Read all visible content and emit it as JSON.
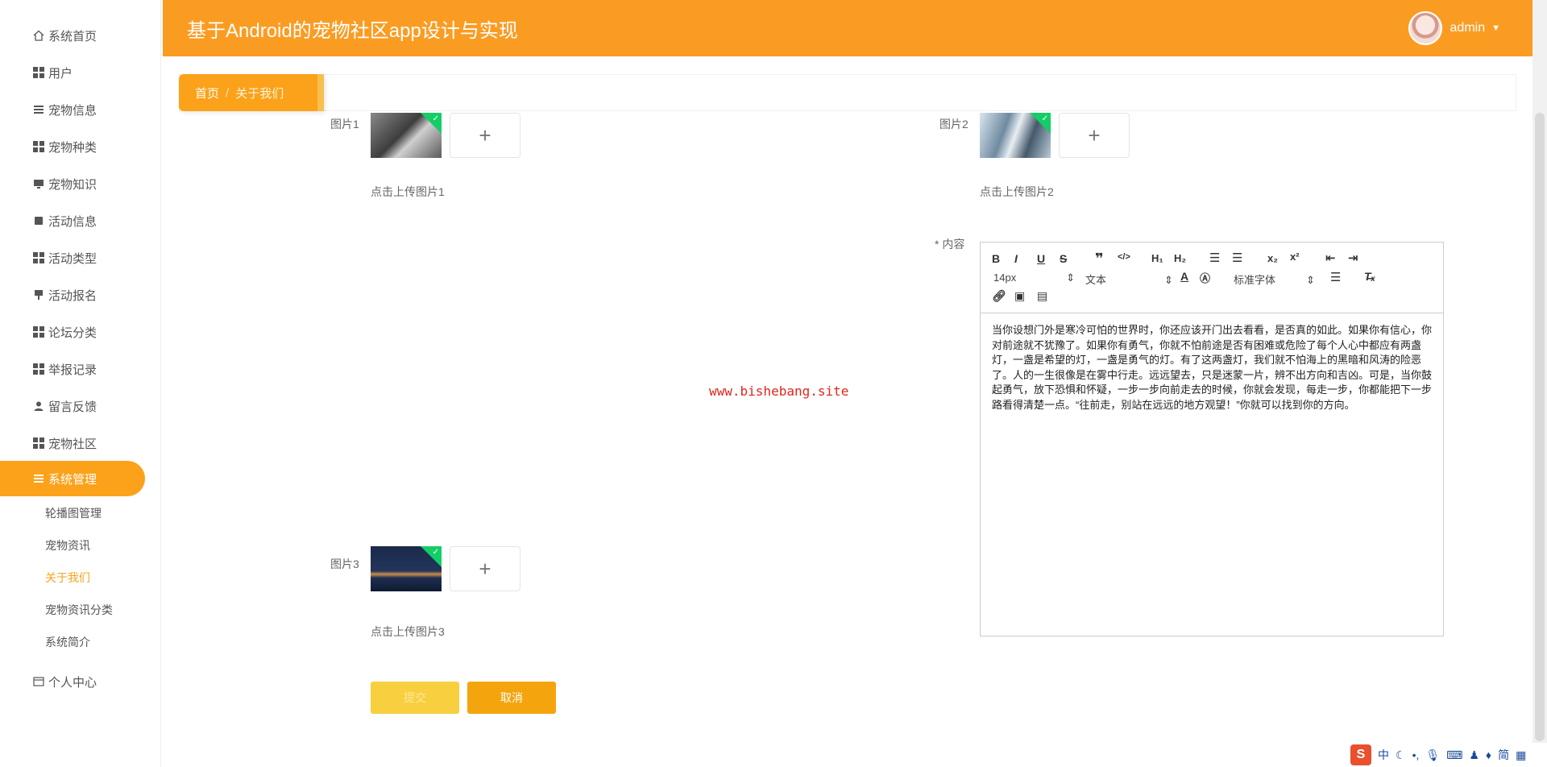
{
  "header": {
    "title": "基于Android的宠物社区app设计与实现",
    "username": "admin"
  },
  "sidebar": {
    "items": [
      {
        "label": "系统首页",
        "icon": "home-icon"
      },
      {
        "label": "用户",
        "icon": "grid-icon"
      },
      {
        "label": "宠物信息",
        "icon": "list-icon"
      },
      {
        "label": "宠物种类",
        "icon": "grid-icon"
      },
      {
        "label": "宠物知识",
        "icon": "monitor-icon"
      },
      {
        "label": "活动信息",
        "icon": "card-icon"
      },
      {
        "label": "活动类型",
        "icon": "grid-icon"
      },
      {
        "label": "活动报名",
        "icon": "pin-icon"
      },
      {
        "label": "论坛分类",
        "icon": "grid-icon"
      },
      {
        "label": "举报记录",
        "icon": "grid-icon"
      },
      {
        "label": "留言反馈",
        "icon": "user-icon"
      },
      {
        "label": "宠物社区",
        "icon": "grid-icon"
      },
      {
        "label": "系统管理",
        "icon": "list-icon"
      }
    ],
    "sub_items": [
      {
        "label": "轮播图管理"
      },
      {
        "label": "宠物资讯"
      },
      {
        "label": "关于我们"
      },
      {
        "label": "宠物资讯分类"
      },
      {
        "label": "系统简介"
      }
    ],
    "personal": "个人中心"
  },
  "breadcrumb": {
    "home": "首页",
    "separator": "/",
    "current": "关于我们"
  },
  "form": {
    "image1_label": "图片1",
    "image1_hint": "点击上传图片1",
    "image2_label": "图片2",
    "image2_hint": "点击上传图片2",
    "image3_label": "图片3",
    "image3_hint": "点击上传图片3",
    "content_label": "* 内容",
    "upload_plus": "+",
    "submit": "提交",
    "cancel": "取消"
  },
  "editor": {
    "font_size": "14px",
    "header_type": "文本",
    "font_family": "标准字体",
    "content": "当你设想门外是寒冷可怕的世界时，你还应该开门出去看看，是否真的如此。如果你有信心，你对前途就不犹豫了。如果你有勇气，你就不怕前途是否有困难或危险了每个人心中都应有两盏灯，一盏是希望的灯，一盏是勇气的灯。有了这两盏灯，我们就不怕海上的黑暗和风涛的险恶了。人的一生很像是在雾中行走。远远望去，只是迷蒙一片，辨不出方向和吉凶。可是，当你鼓起勇气，放下恐惧和怀疑，一步一步向前走去的时候，你就会发现，每走一步，你都能把下一步路看得清楚一点。“往前走，别站在远远的地方观望！”你就可以找到你的方向。"
  },
  "watermark": "www.bishebang.site",
  "tray": {
    "ime": "中",
    "lang": "简"
  },
  "colors": {
    "accent": "#fb9c22",
    "active_menu": "#fba21a",
    "cancel_button": "#f4a50e",
    "submit_button": "#f8cf3e"
  }
}
